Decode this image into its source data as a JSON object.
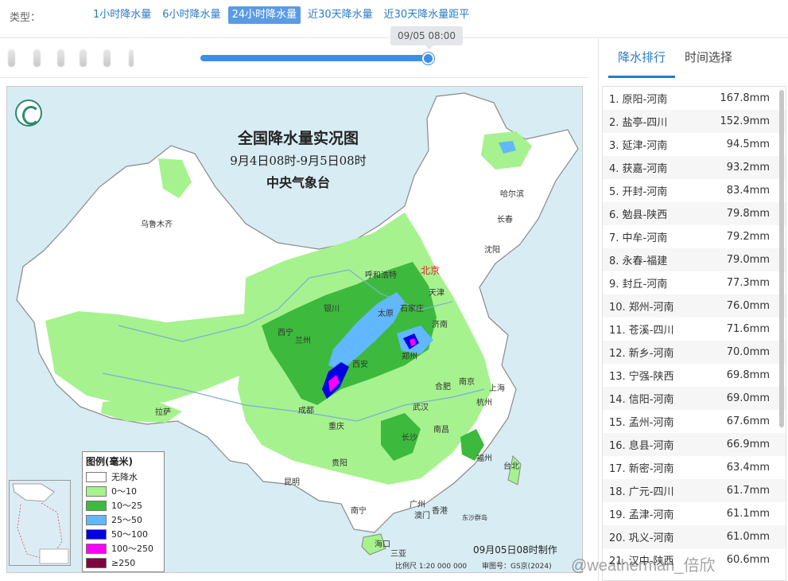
{
  "filter": {
    "label": "类型：",
    "tabs": [
      {
        "label": "1小时降水量"
      },
      {
        "label": "6小时降水量"
      },
      {
        "label": "24小时降水量"
      },
      {
        "label": "近30天降水量"
      },
      {
        "label": "近30天降水量距平"
      }
    ],
    "active_index": 2
  },
  "timeline": {
    "current_time": "09/05 08:00",
    "progress": 1.0
  },
  "map": {
    "title": "全国降水量实况图",
    "period": "9月4日08时-9月5日08时",
    "agency": "中央气象台",
    "cities": [
      {
        "name": "乌鲁木齐"
      },
      {
        "name": "哈尔滨"
      },
      {
        "name": "长春"
      },
      {
        "name": "沈阳"
      },
      {
        "name": "呼和浩特"
      },
      {
        "name": "北京"
      },
      {
        "name": "天津"
      },
      {
        "name": "银川"
      },
      {
        "name": "太原"
      },
      {
        "name": "石家庄"
      },
      {
        "name": "西宁"
      },
      {
        "name": "兰州"
      },
      {
        "name": "济南"
      },
      {
        "name": "郑州"
      },
      {
        "name": "西安"
      },
      {
        "name": "南京"
      },
      {
        "name": "合肥"
      },
      {
        "name": "上海"
      },
      {
        "name": "拉萨"
      },
      {
        "name": "成都"
      },
      {
        "name": "武汉"
      },
      {
        "name": "杭州"
      },
      {
        "name": "重庆"
      },
      {
        "name": "长沙"
      },
      {
        "name": "南昌"
      },
      {
        "name": "福州"
      },
      {
        "name": "台北"
      },
      {
        "name": "贵阳"
      },
      {
        "name": "昆明"
      },
      {
        "name": "南宁"
      },
      {
        "name": "广州"
      },
      {
        "name": "香港"
      },
      {
        "name": "澳门"
      },
      {
        "name": "海口"
      },
      {
        "name": "东沙群岛"
      },
      {
        "name": "三亚"
      }
    ],
    "legend": {
      "title": "图例(毫米)",
      "items": [
        {
          "label": "无降水",
          "color": "#ffffff"
        },
        {
          "label": "0～10",
          "color": "#a6f28f"
        },
        {
          "label": "10～25",
          "color": "#3dba3d"
        },
        {
          "label": "25～50",
          "color": "#61b8ff"
        },
        {
          "label": "50～100",
          "color": "#0000e1"
        },
        {
          "label": "100～250",
          "color": "#fa00fa"
        },
        {
          "label": "≥250",
          "color": "#800040"
        }
      ]
    },
    "made_time": "09月05日08时制作",
    "scale": "比例尺 1:20 000 000",
    "audit": "审图号：GS京(2024)"
  },
  "panel": {
    "tabs": [
      {
        "label": "降水排行"
      },
      {
        "label": "时间选择"
      }
    ],
    "active_index": 0,
    "ranking": [
      {
        "place": "1. 原阳-河南",
        "value": "167.8mm"
      },
      {
        "place": "2. 盐亭-四川",
        "value": "152.9mm"
      },
      {
        "place": "3. 延津-河南",
        "value": "94.5mm"
      },
      {
        "place": "4. 获嘉-河南",
        "value": "93.2mm"
      },
      {
        "place": "5. 开封-河南",
        "value": "83.4mm"
      },
      {
        "place": "6. 勉县-陕西",
        "value": "79.8mm"
      },
      {
        "place": "7. 中牟-河南",
        "value": "79.2mm"
      },
      {
        "place": "8. 永春-福建",
        "value": "79.0mm"
      },
      {
        "place": "9. 封丘-河南",
        "value": "77.3mm"
      },
      {
        "place": "10. 郑州-河南",
        "value": "76.0mm"
      },
      {
        "place": "11. 苍溪-四川",
        "value": "71.6mm"
      },
      {
        "place": "12. 新乡-河南",
        "value": "70.0mm"
      },
      {
        "place": "13. 宁强-陕西",
        "value": "69.8mm"
      },
      {
        "place": "14. 信阳-河南",
        "value": "69.0mm"
      },
      {
        "place": "15. 孟州-河南",
        "value": "67.6mm"
      },
      {
        "place": "16. 息县-河南",
        "value": "66.9mm"
      },
      {
        "place": "17. 新密-河南",
        "value": "63.4mm"
      },
      {
        "place": "18. 广元-四川",
        "value": "61.7mm"
      },
      {
        "place": "19. 孟津-河南",
        "value": "61.1mm"
      },
      {
        "place": "20. 巩义-河南",
        "value": "61.0mm"
      },
      {
        "place": "21. 汉中-陕西",
        "value": "60.6mm"
      }
    ]
  },
  "watermark": "@weatherman_倍欣"
}
